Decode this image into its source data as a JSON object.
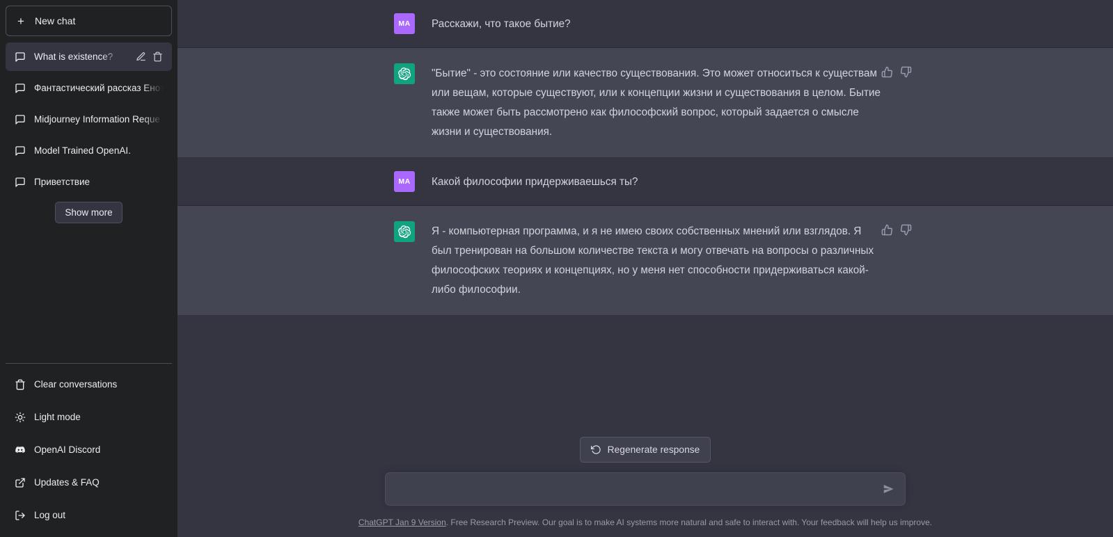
{
  "sidebar": {
    "new_chat_label": "New chat",
    "new_chat_icon": "plus-icon",
    "chats": [
      {
        "label": "What is existence?",
        "icon": "message-icon",
        "active": true,
        "edit_icon": "pencil-icon",
        "delete_icon": "trash-icon"
      },
      {
        "label": "Фантастический рассказ Енот",
        "icon": "message-icon",
        "active": false
      },
      {
        "label": "Midjourney Information Reque",
        "icon": "message-icon",
        "active": false
      },
      {
        "label": "Model Trained OpenAI.",
        "icon": "message-icon",
        "active": false
      },
      {
        "label": "Приветствие",
        "icon": "message-icon",
        "active": false
      }
    ],
    "show_more_label": "Show more",
    "nav": [
      {
        "label": "Clear conversations",
        "icon": "trash-icon"
      },
      {
        "label": "Light mode",
        "icon": "sun-icon"
      },
      {
        "label": "OpenAI Discord",
        "icon": "discord-icon"
      },
      {
        "label": "Updates & FAQ",
        "icon": "external-link-icon"
      },
      {
        "label": "Log out",
        "icon": "logout-icon"
      }
    ]
  },
  "conversation": {
    "messages": [
      {
        "role": "user",
        "avatar_initials": "MA",
        "avatar_color": "#ab68ff",
        "text": "Расскажи, что такое бытие?"
      },
      {
        "role": "assistant",
        "avatar_icon": "openai-logo-icon",
        "avatar_color": "#10a37f",
        "text": "\"Бытие\" - это состояние или качество существования. Это может относиться к существам или вещам, которые существуют, или к концепции жизни и существования в целом. Бытие также может быть рассмотрено как философский вопрос, который задается о смысле жизни и существования.",
        "thumbs_up_icon": "thumbs-up-icon",
        "thumbs_down_icon": "thumbs-down-icon"
      },
      {
        "role": "user",
        "avatar_initials": "MA",
        "avatar_color": "#ab68ff",
        "text": "Какой философии придерживаешься ты?"
      },
      {
        "role": "assistant",
        "avatar_icon": "openai-logo-icon",
        "avatar_color": "#10a37f",
        "text": "Я - компьютерная программа, и я не имею своих собственных мнений или взглядов. Я был тренирован на большом количестве текста и могу отвечать на вопросы о различных философских теориях и концепциях, но у меня нет способности придерживаться какой-либо философии.",
        "thumbs_up_icon": "thumbs-up-icon",
        "thumbs_down_icon": "thumbs-down-icon"
      }
    ]
  },
  "composer": {
    "regenerate_label": "Regenerate response",
    "regenerate_icon": "refresh-icon",
    "input_value": "",
    "input_placeholder": "",
    "send_icon": "send-icon"
  },
  "footer": {
    "link_text": "ChatGPT Jan 9 Version",
    "rest_text": ". Free Research Preview. Our goal is to make AI systems more natural and safe to interact with. Your feedback will help us improve."
  },
  "colors": {
    "sidebar_bg": "#202123",
    "user_row_bg": "#343541",
    "assistant_row_bg": "#444654",
    "accent_green": "#10a37f",
    "accent_purple": "#ab68ff"
  }
}
